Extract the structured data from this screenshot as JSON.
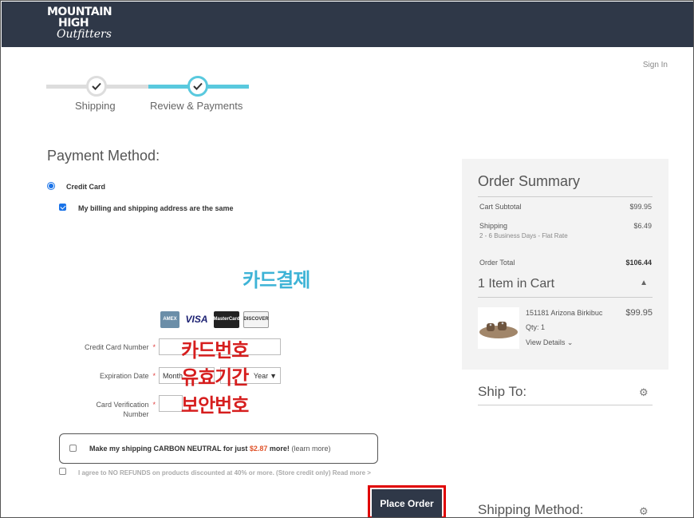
{
  "brand": {
    "line1": "MOUNTAIN",
    "line2": "HIGH",
    "line3": "Outfitters"
  },
  "header": {
    "sign_in": "Sign In"
  },
  "progress": {
    "steps": [
      {
        "label": "Shipping"
      },
      {
        "label": "Review & Payments"
      }
    ]
  },
  "payment": {
    "title": "Payment Method:",
    "credit_card_label": "Credit Card",
    "billing_same_label": "My billing and shipping address are the same",
    "card_logos": [
      "AMEX",
      "VISA",
      "MasterCard",
      "DISCOVER"
    ],
    "card_number_label": "Credit Card Number",
    "expiration_label": "Expiration Date",
    "month_placeholder": "Month",
    "year_placeholder": "Year",
    "cvv_label_line1": "Card Verification",
    "cvv_label_line2": "Number",
    "required_mark": "*"
  },
  "annotations": {
    "card_payment": "카드결제",
    "card_number": "카드번호",
    "expiry": "유효기간",
    "security_code": "보안번호"
  },
  "carbon": {
    "text": "Make my shipping CARBON NEUTRAL for just",
    "price": "$2.87",
    "suffix": "more!",
    "learn_more": "(learn more)"
  },
  "refund": {
    "text": "I agree to NO REFUNDS on products discounted at 40% or more. (Store credit only) Read more >"
  },
  "place_order": "Place Order",
  "summary": {
    "title": "Order Summary",
    "subtotal_label": "Cart Subtotal",
    "subtotal_value": "$99.95",
    "shipping_label": "Shipping",
    "shipping_sub": "2 - 6 Business Days - Flat Rate",
    "shipping_value": "$6.49",
    "total_label": "Order Total",
    "total_value": "$106.44",
    "cart_heading": "1 Item in Cart",
    "item": {
      "name": "151181 Arizona Birkibuc",
      "price": "$99.95",
      "qty": "Qty: 1",
      "details": "View Details"
    }
  },
  "ship_to": "Ship To:",
  "shipping_method": "Shipping Method:"
}
